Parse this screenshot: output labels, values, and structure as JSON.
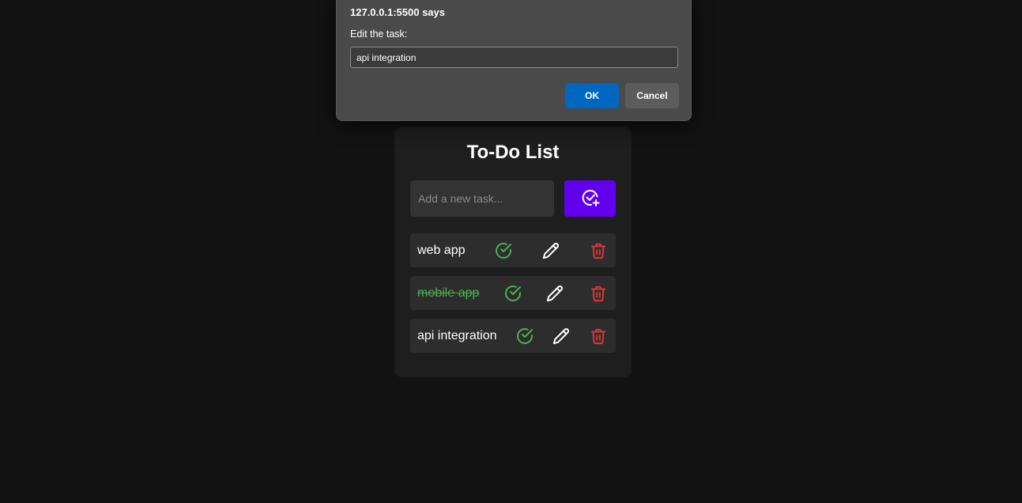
{
  "dialog": {
    "title": "127.0.0.1:5500 says",
    "message": "Edit the task:",
    "input_value": "api integration",
    "ok_label": "OK",
    "cancel_label": "Cancel"
  },
  "todo": {
    "title": "To-Do List",
    "input_placeholder": "Add a new task...",
    "add_icon": "circle-check-plus-icon",
    "tasks": [
      {
        "text": "web app",
        "completed": false
      },
      {
        "text": "mobile app",
        "completed": true
      },
      {
        "text": "api integration",
        "completed": false
      }
    ]
  },
  "colors": {
    "background": "#121212",
    "card": "#1e1e1e",
    "row": "#2d2d2d",
    "accent": "#6200ee",
    "complete": "#4caf50",
    "delete": "#e53935",
    "dialog": "#4a4a4a",
    "ok": "#0067c0"
  },
  "icons": {
    "complete": "check-circle-icon",
    "edit": "pencil-icon",
    "delete": "trash-icon"
  }
}
